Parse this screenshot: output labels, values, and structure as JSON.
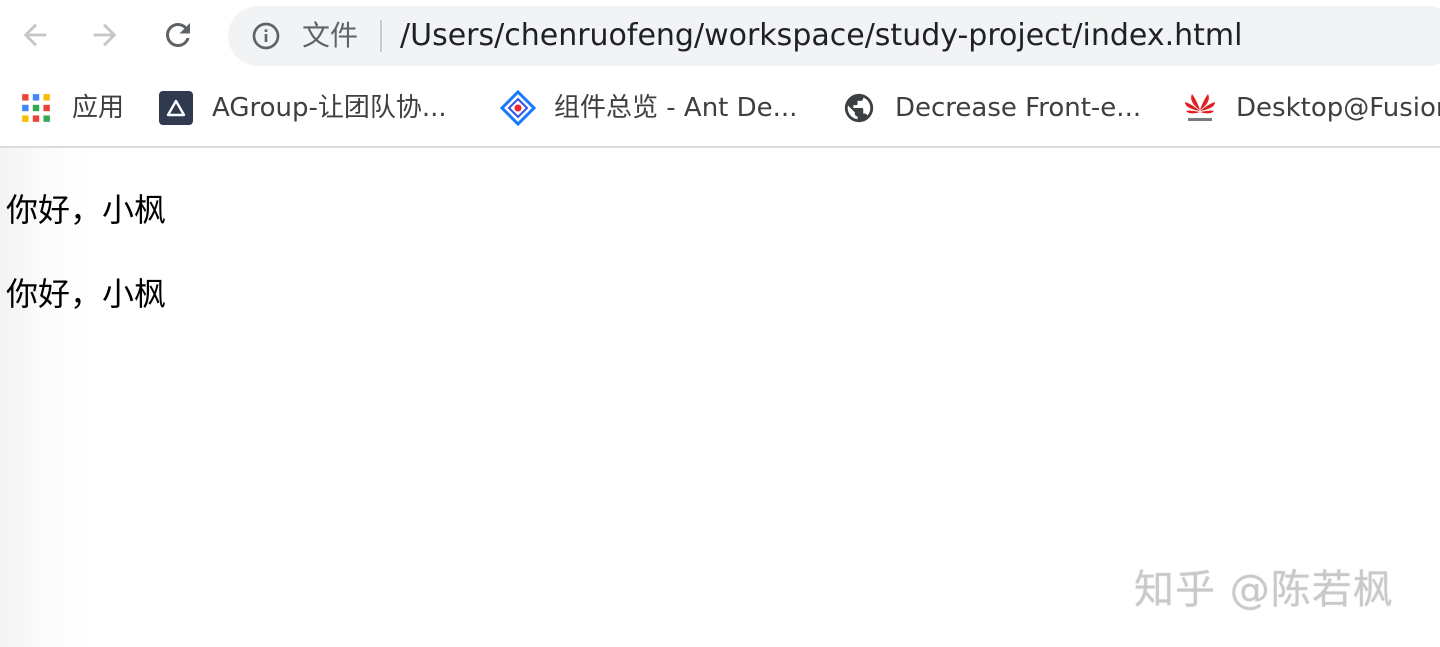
{
  "toolbar": {
    "omnibox": {
      "chip_label": "文件",
      "url": "/Users/chenruofeng/workspace/study-project/index.html",
      "info_icon": "info-icon"
    },
    "nav_icons": [
      "back-arrow-icon",
      "forward-arrow-icon",
      "reload-icon"
    ]
  },
  "bookmarks": {
    "items": [
      {
        "label": "应用",
        "icon": "apps-grid-icon"
      },
      {
        "label": "AGroup-让团队协...",
        "icon": "agroup-logo-icon"
      },
      {
        "label": "组件总览 - Ant De...",
        "icon": "ant-design-logo-icon"
      },
      {
        "label": "Decrease Front-e...",
        "icon": "globe-icon"
      },
      {
        "label": "Desktop@Fusion",
        "icon": "huawei-logo-icon"
      }
    ]
  },
  "page": {
    "paragraphs": [
      "你好，小枫",
      "你好，小枫"
    ]
  },
  "watermark": {
    "text": "知乎 @陈若枫"
  },
  "colors": {
    "omnibox_bg": "#f1f3f4",
    "icon_gray": "#5f6368",
    "disabled_arrow": "#c4c7c5",
    "text_dark": "#202124"
  }
}
